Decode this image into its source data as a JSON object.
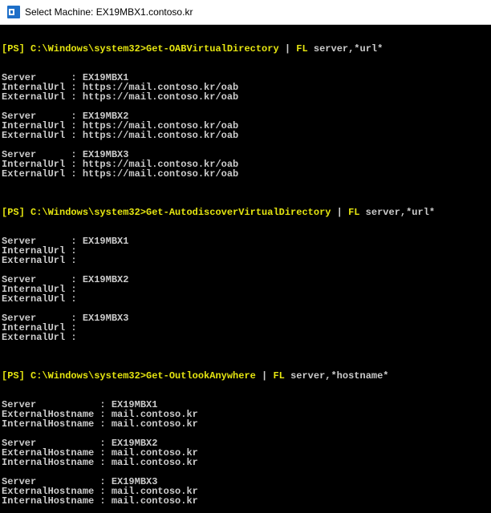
{
  "window": {
    "title": "Select Machine: EX19MBX1.contoso.kr",
    "icon": "exchange-management-shell-icon"
  },
  "colors": {
    "console_bg": "#000000",
    "text": "#cccccc",
    "command_highlight": "#e5e510"
  },
  "console": {
    "commands": [
      {
        "prompt": "[PS] C:\\Windows\\system32>",
        "cmdlet": "Get-OABVirtualDirectory",
        "pipe": " | ",
        "fl": "FL",
        "args": " server,*url*",
        "results": [
          "Server      : EX19MBX1\nInternalUrl : https://mail.contoso.kr/oab\nExternalUrl : https://mail.contoso.kr/oab",
          "Server      : EX19MBX2\nInternalUrl : https://mail.contoso.kr/oab\nExternalUrl : https://mail.contoso.kr/oab",
          "Server      : EX19MBX3\nInternalUrl : https://mail.contoso.kr/oab\nExternalUrl : https://mail.contoso.kr/oab"
        ]
      },
      {
        "prompt": "[PS] C:\\Windows\\system32>",
        "cmdlet": "Get-AutodiscoverVirtualDirectory",
        "pipe": " | ",
        "fl": "FL",
        "args": " server,*url*",
        "results": [
          "Server      : EX19MBX1\nInternalUrl :\nExternalUrl :",
          "Server      : EX19MBX2\nInternalUrl :\nExternalUrl :",
          "Server      : EX19MBX3\nInternalUrl :\nExternalUrl :"
        ]
      },
      {
        "prompt": "[PS] C:\\Windows\\system32>",
        "cmdlet": "Get-OutlookAnywhere",
        "pipe": " | ",
        "fl": "FL",
        "args": " server,*hostname*",
        "results": [
          "Server           : EX19MBX1\nExternalHostname : mail.contoso.kr\nInternalHostname : mail.contoso.kr",
          "Server           : EX19MBX2\nExternalHostname : mail.contoso.kr\nInternalHostname : mail.contoso.kr",
          "Server           : EX19MBX3\nExternalHostname : mail.contoso.kr\nInternalHostname : mail.contoso.kr"
        ]
      }
    ]
  }
}
